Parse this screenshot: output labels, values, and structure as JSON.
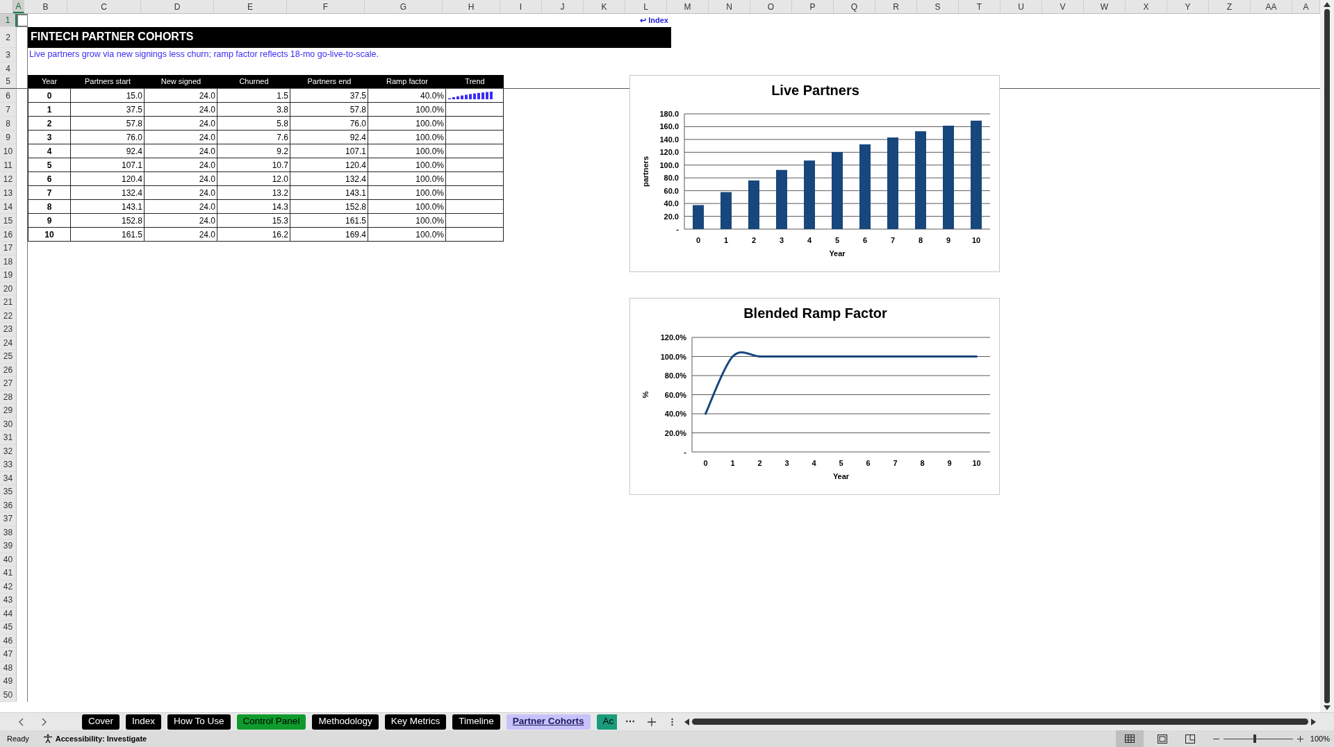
{
  "column_headers": [
    {
      "label": "A",
      "selected": true
    },
    {
      "label": "B",
      "selected": false
    },
    {
      "label": "C",
      "selected": false
    },
    {
      "label": "D",
      "selected": false
    },
    {
      "label": "E",
      "selected": false
    },
    {
      "label": "F",
      "selected": false
    },
    {
      "label": "G",
      "selected": false
    },
    {
      "label": "H",
      "selected": false
    },
    {
      "label": "I",
      "selected": false
    },
    {
      "label": "J",
      "selected": false
    },
    {
      "label": "K",
      "selected": false
    },
    {
      "label": "L",
      "selected": false
    },
    {
      "label": "M",
      "selected": false
    },
    {
      "label": "N",
      "selected": false
    },
    {
      "label": "O",
      "selected": false
    },
    {
      "label": "P",
      "selected": false
    },
    {
      "label": "Q",
      "selected": false
    },
    {
      "label": "R",
      "selected": false
    },
    {
      "label": "S",
      "selected": false
    },
    {
      "label": "T",
      "selected": false
    },
    {
      "label": "U",
      "selected": false
    },
    {
      "label": "V",
      "selected": false
    },
    {
      "label": "W",
      "selected": false
    },
    {
      "label": "X",
      "selected": false
    },
    {
      "label": "Y",
      "selected": false
    },
    {
      "label": "Z",
      "selected": false
    },
    {
      "label": "AA",
      "selected": false
    },
    {
      "label": "A",
      "selected": false
    }
  ],
  "row_headers": [
    {
      "label": "1",
      "selected": true
    },
    {
      "label": "2",
      "selected": false
    },
    {
      "label": "3",
      "selected": false
    },
    {
      "label": "4",
      "selected": false
    },
    {
      "label": "5",
      "selected": false
    },
    {
      "label": "6",
      "selected": false
    },
    {
      "label": "7",
      "selected": false
    },
    {
      "label": "8",
      "selected": false
    },
    {
      "label": "9",
      "selected": false
    },
    {
      "label": "10",
      "selected": false
    },
    {
      "label": "11",
      "selected": false
    },
    {
      "label": "12",
      "selected": false
    },
    {
      "label": "13",
      "selected": false
    },
    {
      "label": "14",
      "selected": false
    },
    {
      "label": "15",
      "selected": false
    },
    {
      "label": "16",
      "selected": false
    },
    {
      "label": "17",
      "selected": false
    },
    {
      "label": "18",
      "selected": false
    },
    {
      "label": "19",
      "selected": false
    },
    {
      "label": "20",
      "selected": false
    },
    {
      "label": "21",
      "selected": false
    },
    {
      "label": "22",
      "selected": false
    },
    {
      "label": "23",
      "selected": false
    },
    {
      "label": "24",
      "selected": false
    },
    {
      "label": "25",
      "selected": false
    },
    {
      "label": "26",
      "selected": false
    },
    {
      "label": "27",
      "selected": false
    },
    {
      "label": "28",
      "selected": false
    },
    {
      "label": "29",
      "selected": false
    },
    {
      "label": "30",
      "selected": false
    },
    {
      "label": "31",
      "selected": false
    },
    {
      "label": "32",
      "selected": false
    },
    {
      "label": "33",
      "selected": false
    },
    {
      "label": "34",
      "selected": false
    },
    {
      "label": "35",
      "selected": false
    },
    {
      "label": "36",
      "selected": false
    },
    {
      "label": "37",
      "selected": false
    },
    {
      "label": "38",
      "selected": false
    },
    {
      "label": "39",
      "selected": false
    },
    {
      "label": "40",
      "selected": false
    },
    {
      "label": "41",
      "selected": false
    },
    {
      "label": "42",
      "selected": false
    },
    {
      "label": "43",
      "selected": false
    },
    {
      "label": "44",
      "selected": false
    },
    {
      "label": "45",
      "selected": false
    },
    {
      "label": "46",
      "selected": false
    },
    {
      "label": "47",
      "selected": false
    },
    {
      "label": "48",
      "selected": false
    },
    {
      "label": "49",
      "selected": false
    },
    {
      "label": "50",
      "selected": false
    }
  ],
  "index_link": "↩ Index",
  "title": "FINTECH PARTNER COHORTS",
  "subtitle": "Live partners grow via new signings less churn; ramp factor reflects 18-mo go-live-to-scale.",
  "table": {
    "columns": [
      "Year",
      "Partners start",
      "New signed",
      "Churned",
      "Partners end",
      "Ramp factor",
      "Trend"
    ],
    "rows": [
      [
        "0",
        "15.0",
        "24.0",
        "1.5",
        "37.5",
        "40.0%"
      ],
      [
        "1",
        "37.5",
        "24.0",
        "3.8",
        "57.8",
        "100.0%"
      ],
      [
        "2",
        "57.8",
        "24.0",
        "5.8",
        "76.0",
        "100.0%"
      ],
      [
        "3",
        "76.0",
        "24.0",
        "7.6",
        "92.4",
        "100.0%"
      ],
      [
        "4",
        "92.4",
        "24.0",
        "9.2",
        "107.1",
        "100.0%"
      ],
      [
        "5",
        "107.1",
        "24.0",
        "10.7",
        "120.4",
        "100.0%"
      ],
      [
        "6",
        "120.4",
        "24.0",
        "12.0",
        "132.4",
        "100.0%"
      ],
      [
        "7",
        "132.4",
        "24.0",
        "13.2",
        "143.1",
        "100.0%"
      ],
      [
        "8",
        "143.1",
        "24.0",
        "14.3",
        "152.8",
        "100.0%"
      ],
      [
        "9",
        "152.8",
        "24.0",
        "15.3",
        "161.5",
        "100.0%"
      ],
      [
        "10",
        "161.5",
        "24.0",
        "16.2",
        "169.4",
        "100.0%"
      ]
    ]
  },
  "charts": [
    {
      "chart_data": {
        "type": "bar",
        "title": "Live Partners",
        "xlabel": "Year",
        "ylabel": "partners",
        "categories": [
          "0",
          "1",
          "2",
          "3",
          "4",
          "5",
          "6",
          "7",
          "8",
          "9",
          "10"
        ],
        "grid": true,
        "series": [
          {
            "color": "#17477c",
            "values": [
              37.5,
              57.8,
              76.0,
              92.4,
              107.1,
              120.4,
              132.4,
              143.1,
              152.8,
              161.5,
              169.4
            ]
          }
        ],
        "ylim": [
          0,
          180
        ],
        "yticks": [
          {
            "value": 0,
            "label": "-"
          },
          {
            "value": 20,
            "label": "20.0"
          },
          {
            "value": 40,
            "label": "40.0"
          },
          {
            "value": 60,
            "label": "60.0"
          },
          {
            "value": 80,
            "label": "80.0"
          },
          {
            "value": 100,
            "label": "100.0"
          },
          {
            "value": 120,
            "label": "120.0"
          },
          {
            "value": 140,
            "label": "140.0"
          },
          {
            "value": 160,
            "label": "160.0"
          },
          {
            "value": 180,
            "label": "180.0"
          }
        ]
      }
    },
    {
      "chart_data": {
        "type": "line",
        "title": "Blended Ramp Factor",
        "xlabel": "Year",
        "ylabel": "%",
        "categories": [
          "0",
          "1",
          "2",
          "3",
          "4",
          "5",
          "6",
          "7",
          "8",
          "9",
          "10"
        ],
        "grid": true,
        "series": [
          {
            "color": "#17477c",
            "values": [
              0.4,
              1.0,
              1.0,
              1.0,
              1.0,
              1.0,
              1.0,
              1.0,
              1.0,
              1.0,
              1.0
            ]
          }
        ],
        "ylim": [
          0,
          1.2
        ],
        "yticks": [
          {
            "value": 0,
            "label": "-"
          },
          {
            "value": 0.2,
            "label": "20.0%"
          },
          {
            "value": 0.4,
            "label": "40.0%"
          },
          {
            "value": 0.6,
            "label": "60.0%"
          },
          {
            "value": 0.8,
            "label": "80.0%"
          },
          {
            "value": 1.0,
            "label": "100.0%"
          },
          {
            "value": 1.2,
            "label": "120.0%"
          }
        ]
      }
    }
  ],
  "sheet_tabs": [
    {
      "label": "Cover",
      "color": "#000000",
      "selected": false
    },
    {
      "label": "Index",
      "color": "#000000",
      "selected": false
    },
    {
      "label": "How To Use",
      "color": "#000000",
      "selected": false
    },
    {
      "label": "Control Panel",
      "color": "#0f9b2c",
      "selected": false
    },
    {
      "label": "Methodology",
      "color": "#000000",
      "selected": false
    },
    {
      "label": "Key Metrics",
      "color": "#000000",
      "selected": false
    },
    {
      "label": "Timeline",
      "color": "#000000",
      "selected": false
    },
    {
      "label": "Partner Cohorts",
      "color": "#c8c2fb",
      "selected": true
    },
    {
      "label": "Ac",
      "color": "#1a9b7b",
      "selected": false
    }
  ],
  "more_tabs": "⋯",
  "status_bar": {
    "mode": "Ready",
    "accessibility": "Accessibility: Investigate",
    "zoom_slider": {
      "level": 0.45
    },
    "zoom": "100%"
  }
}
